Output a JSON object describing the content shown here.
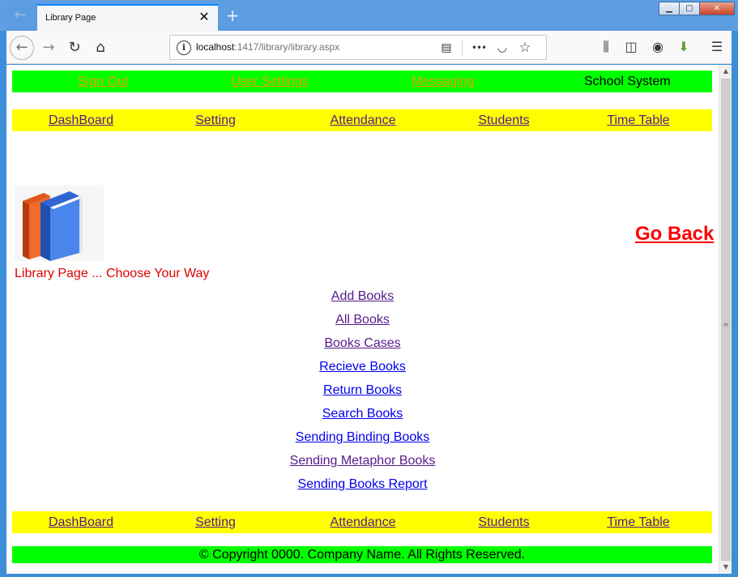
{
  "browser": {
    "tab_title": "Library Page",
    "tab_close": "✕",
    "new_tab": "+",
    "url_host": "localhost",
    "url_path": ":1417/library/library.aspx",
    "window_controls": {
      "minimize": "▁",
      "maximize": "▢",
      "close": "✕"
    },
    "icons": {
      "back": "←",
      "forward": "→",
      "reload": "↻",
      "home": "⌂",
      "site_info": "i",
      "reader_mode": "▤",
      "page_actions": "•••",
      "pocket": "◡",
      "bookmark_star": "☆",
      "library": "⫼",
      "sidebar": "◫",
      "account": "◉",
      "download": "⬇",
      "menu": "☰"
    }
  },
  "page": {
    "top_nav": {
      "links": [
        "Sign Out",
        "User Settings",
        "Messaging"
      ],
      "brand": "School System"
    },
    "menu": [
      "DashBoard",
      "Setting",
      "Attendance",
      "Students",
      "Time Table"
    ],
    "caption": "Library Page ... Choose Your Way",
    "go_back": "Go Back",
    "links": [
      {
        "label": "Add Books",
        "visited": true
      },
      {
        "label": "All Books",
        "visited": true
      },
      {
        "label": "Books Cases",
        "visited": true
      },
      {
        "label": "Recieve Books",
        "visited": false
      },
      {
        "label": "Return Books",
        "visited": false
      },
      {
        "label": "Search Books",
        "visited": false
      },
      {
        "label": "Sending Binding Books",
        "visited": false
      },
      {
        "label": "Sending Metaphor Books",
        "visited": true
      },
      {
        "label": "Sending Books Report",
        "visited": false
      }
    ],
    "footer_menu": [
      "DashBoard",
      "Setting",
      "Attendance",
      "Students",
      "Time Table"
    ],
    "footer": "© Copyright 0000. Company Name. All Rights Reserved."
  },
  "colors": {
    "top_bar": "#00ff00",
    "menu_bar": "#ffff00",
    "top_link": "#e6a400",
    "visited_link": "#551a8b",
    "unvisited_link": "#0000ee",
    "caption": "#e00000",
    "go_back": "#ff0000"
  }
}
